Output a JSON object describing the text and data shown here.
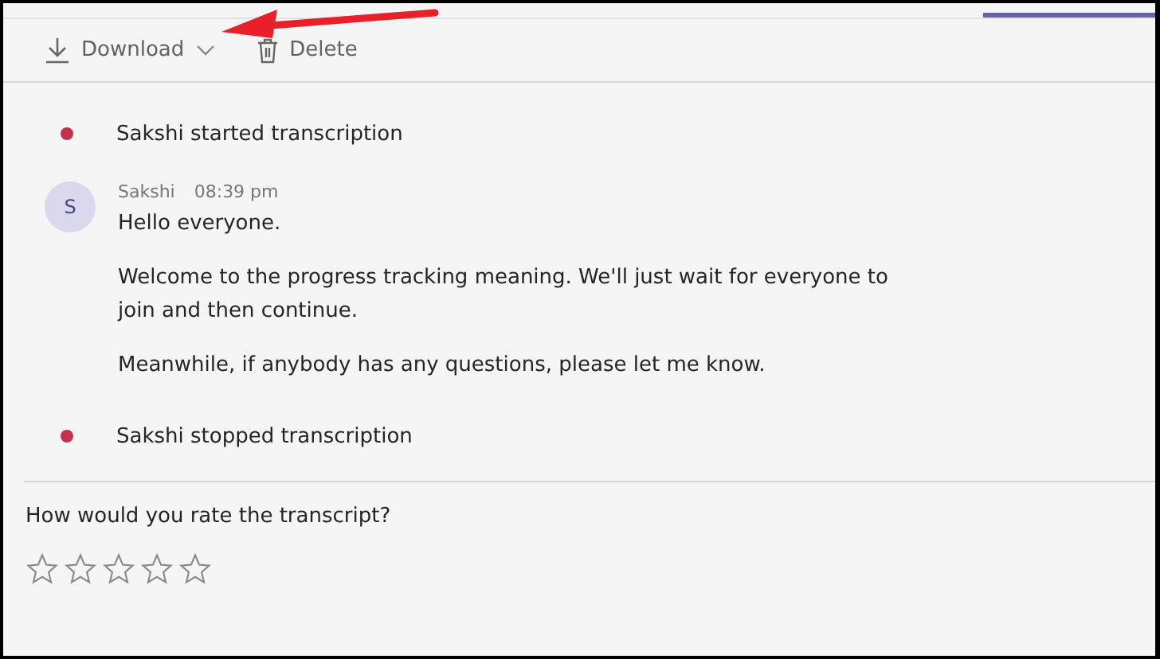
{
  "toolbar": {
    "buttons": [
      {
        "kind": "download",
        "label": "Download"
      },
      {
        "kind": "delete",
        "label": "Delete"
      }
    ]
  },
  "transcript": [
    {
      "kind": "event",
      "text": "Sakshi started transcription"
    },
    {
      "kind": "message",
      "avatar": "S",
      "author": "Sakshi",
      "time": "08:39 pm",
      "paragraphs": [
        "Hello everyone.",
        "Welcome to the progress tracking meaning. We'll just wait for everyone to join and then continue.",
        "Meanwhile, if anybody has any questions, please let me know."
      ]
    },
    {
      "kind": "event",
      "text": "Sakshi stopped transcription"
    }
  ],
  "rating": {
    "question": "How would you rate the transcript?",
    "stars": 0
  }
}
